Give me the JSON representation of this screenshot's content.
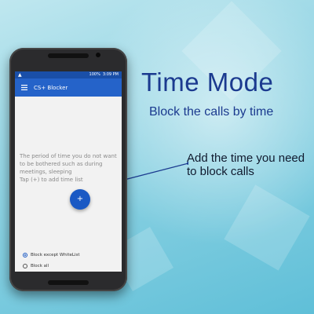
{
  "promo": {
    "headline": "Time Mode",
    "subheadline": "Block the calls by time",
    "callout": "Add the time you need to block calls"
  },
  "status_bar": {
    "signal": "▲",
    "battery": "100%",
    "time": "3:09 PM"
  },
  "app_bar": {
    "title": "CS+ Blocker",
    "menu_icon": "hamburger-menu-icon"
  },
  "empty_state": {
    "text": "The period of time you do not want to be bothered such as during meetings, sleeping\nTap (+) to add time list"
  },
  "fab": {
    "label": "+",
    "icon": "add-icon"
  },
  "block_options": [
    {
      "label": "Block except WhiteList",
      "selected": true
    },
    {
      "label": "Block all",
      "selected": false
    }
  ],
  "colors": {
    "accent": "#2563c9",
    "headline": "#1b3a8f",
    "background": "#8fd3e3"
  }
}
